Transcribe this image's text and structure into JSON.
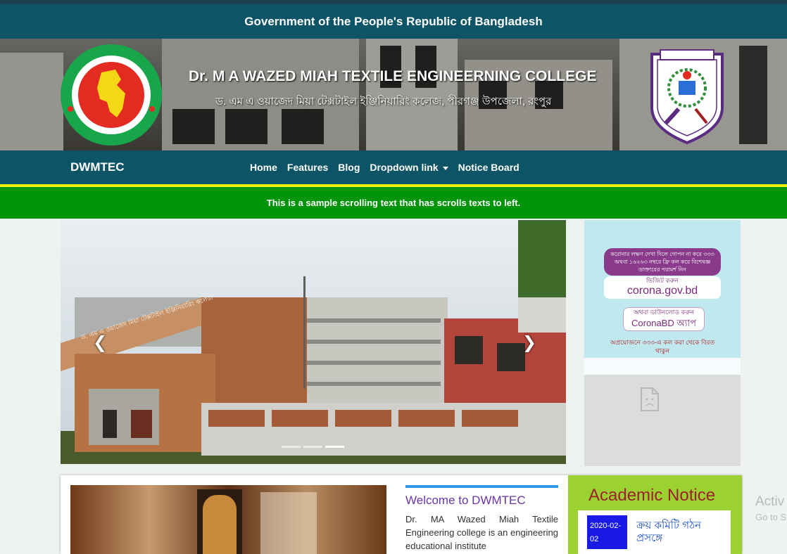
{
  "gov_bar": {
    "text": "Government of the People's Republic of Bangladesh"
  },
  "header": {
    "title": "Dr. M A WAZED MIAH TEXTILE ENGINEERNING COLLEGE",
    "subtitle_bn": "ড. এম এ ওয়াজেদ মিয়া টেক্সটাইল ইঞ্জিনিয়ারিং কলেজ, পীরগঞ্জ উপজেলা, রংপুর"
  },
  "navbar": {
    "brand": "DWMTEC",
    "items": [
      {
        "label": "Home"
      },
      {
        "label": "Features"
      },
      {
        "label": "Blog"
      },
      {
        "label": "Dropdown link"
      },
      {
        "label": "Notice Board"
      }
    ]
  },
  "marquee": {
    "text": "This is a sample scrolling text that has scrolls texts to left."
  },
  "carousel": {
    "prev_glyph": "❮",
    "next_glyph": "❯",
    "slide_count": 3,
    "active_slide": 3
  },
  "photo_sign": {
    "line1": "ড. এম এ ওয়াজেদ মিয়া টেক্সটাইল ইঞ্জিনিয়ারিং কলেজ"
  },
  "poster": {
    "pill": "করোনার লক্ষণ দেখা দিলে গোপন না করে ৩৩৩ অথবা ১৬২৬৩ নম্বরে ফ্রি কল করে বিশেষজ্ঞ ডাক্তারের পরামর্শ নিন",
    "visit_label": "ভিজিট করুন",
    "visit_url": "corona.gov.bd",
    "download_label": "অথবা ডাউনলোড করুন",
    "app_name": "CoronaBD অ্যাপ",
    "footer": "অপ্রয়োজনে ৩৩৩-এ কল করা থেকে বিরত থাকুন"
  },
  "welcome": {
    "title": "Welcome to DWMTEC",
    "text": "Dr. MA Wazed Miah Textile Engineering college is an engineering educational institute"
  },
  "notice": {
    "title": "Academic Notice",
    "items": [
      {
        "date": "2020-02-02",
        "text": "ক্রয় কমিটি গঠন প্রসঙ্গে"
      }
    ]
  },
  "watermark": {
    "line1": "Activ",
    "line2": "Go to S"
  },
  "colors": {
    "nav": "#0d5566",
    "marquee": "#02940a",
    "notice_bg": "#9bd232",
    "notice_title": "#9c1f2e"
  }
}
